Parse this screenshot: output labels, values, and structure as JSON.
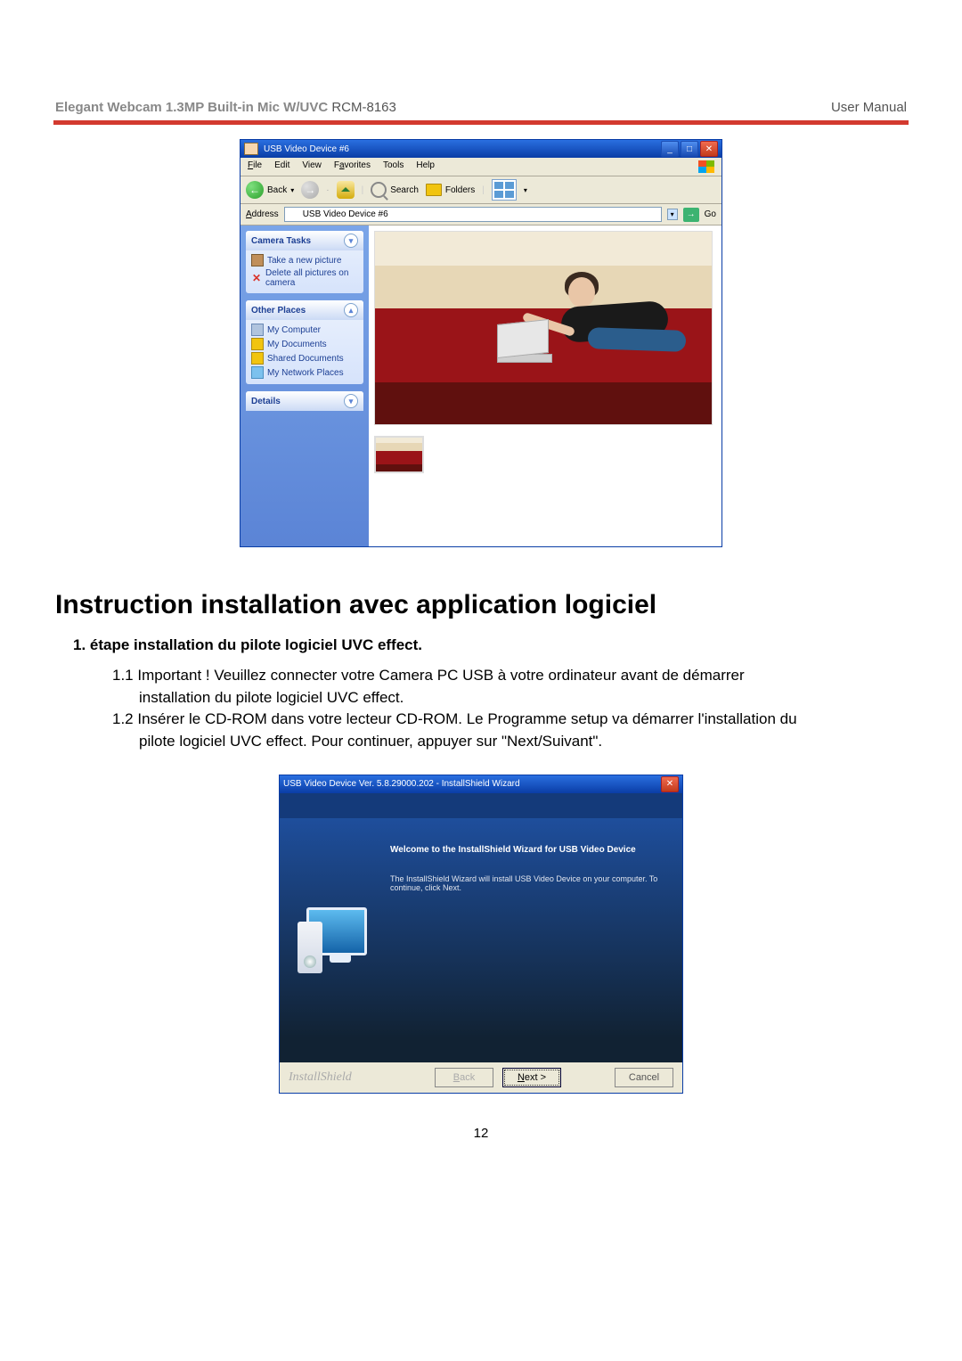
{
  "header": {
    "product": "Elegant  Webcam 1.3MP Built-in Mic W/UVC",
    "model": "RCM-8163",
    "right": "User  Manual"
  },
  "explorer": {
    "title": "USB Video Device #6",
    "menu": {
      "file": "File",
      "edit": "Edit",
      "view": "View",
      "favorites": "Favorites",
      "tools": "Tools",
      "help": "Help"
    },
    "toolbar": {
      "back": "Back",
      "search": "Search",
      "folders": "Folders"
    },
    "address": {
      "label": "Address",
      "value": "USB Video Device #6",
      "go": "Go"
    },
    "tasks": {
      "camera": {
        "hdr": "Camera Tasks",
        "take": "Take a new picture",
        "delete": "Delete all pictures on camera"
      },
      "other": {
        "hdr": "Other Places",
        "mycomp": "My Computer",
        "mydocs": "My Documents",
        "shared": "Shared Documents",
        "network": "My Network Places"
      },
      "details": {
        "hdr": "Details"
      }
    }
  },
  "doc": {
    "h1": "Instruction installation avec application logiciel",
    "step1_label": "1.   étape installation du pilote logiciel UVC effect.",
    "s11": "1.1 Important ! Veuillez connecter votre Camera PC USB à votre ordinateur avant de démarrer",
    "s11b": "installation du pilote logiciel UVC effect.",
    "s12": "1.2 Insérer le CD-ROM dans votre lecteur CD-ROM. Le Programme setup va démarrer l'installation du",
    "s12b": "pilote logiciel UVC effect. Pour continuer, appuyer sur \"Next/Suivant\"."
  },
  "installer": {
    "title": "USB Video Device Ver. 5.8.29000.202 - InstallShield Wizard",
    "welcome": "Welcome to the InstallShield Wizard for USB Video Device",
    "msg": "The InstallShield Wizard will install USB Video Device on your computer.  To continue, click Next.",
    "brand": "InstallShield",
    "back": "< Back",
    "next": "Next >",
    "cancel": "Cancel"
  },
  "pagenum": "12"
}
